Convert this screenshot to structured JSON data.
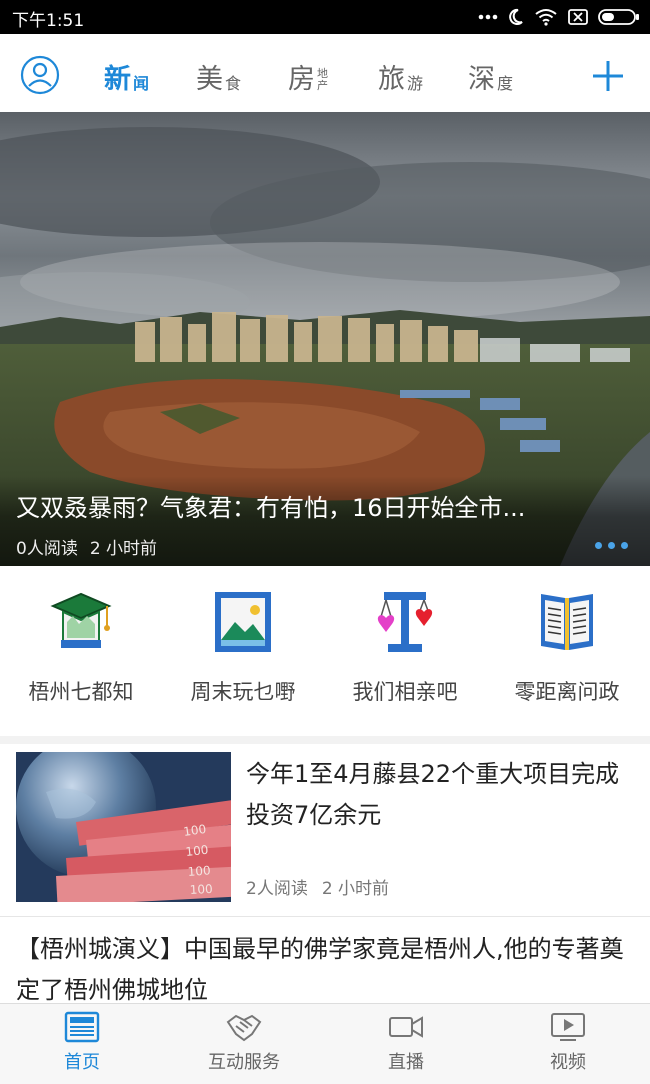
{
  "status_bar": {
    "time": "下午1:51",
    "icons": [
      "dots-icon",
      "moon-icon",
      "wifi-icon",
      "sim-icon",
      "battery-icon"
    ]
  },
  "top_nav": {
    "tabs": [
      {
        "main": "新",
        "sub": "闻",
        "active": true
      },
      {
        "main": "美",
        "sub": "食"
      },
      {
        "main": "房",
        "sub_top": "地",
        "sub_bottom": "产"
      },
      {
        "main": "旅",
        "sub": "游"
      },
      {
        "main": "深",
        "sub": "度"
      }
    ],
    "accent_color": "#1e88d8"
  },
  "hero": {
    "title": "又双叒暴雨？气象君：冇有怕，16日开始全市...",
    "reads": "0人阅读",
    "time": "2 小时前"
  },
  "quick_links": [
    {
      "label": "梧州七都知",
      "icon": "graduation-cap-icon"
    },
    {
      "label": "周末玩乜嘢",
      "icon": "picture-icon"
    },
    {
      "label": "我们相亲吧",
      "icon": "scale-hearts-icon"
    },
    {
      "label": "零距离问政",
      "icon": "open-book-icon"
    }
  ],
  "news": [
    {
      "title": "今年1至4月藤县22个重大项目完成投资7亿余元",
      "reads": "2人阅读",
      "time": "2 小时前"
    },
    {
      "title": "【梧州城演义】中国最早的佛学家竟是梧州人,他的专著奠定了梧州佛城地位"
    }
  ],
  "bottom_nav": [
    {
      "label": "首页",
      "icon": "newspaper-icon",
      "active": true
    },
    {
      "label": "互动服务",
      "icon": "handshake-icon"
    },
    {
      "label": "直播",
      "icon": "video-camera-icon"
    },
    {
      "label": "视频",
      "icon": "play-screen-icon"
    }
  ]
}
